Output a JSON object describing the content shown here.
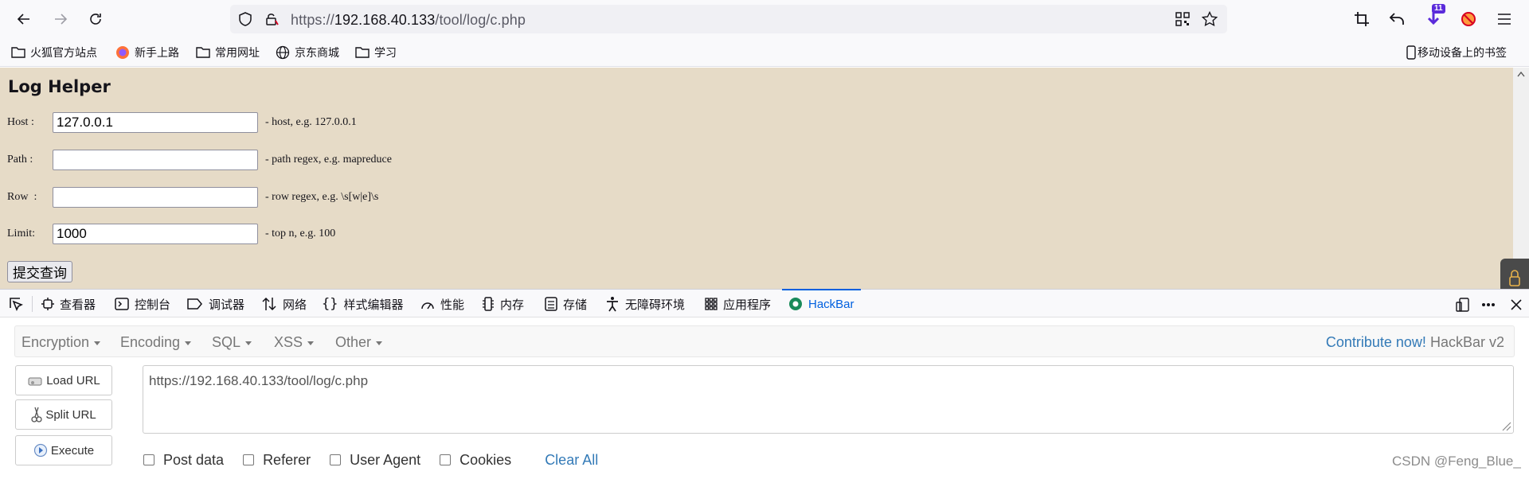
{
  "browser": {
    "url_prefix": "https://",
    "url_host": "192.168.40.133",
    "url_path": "/tool/log/c.php",
    "extension_badge": "11"
  },
  "bookmarks": [
    {
      "label": "火狐官方站点",
      "icon": "folder-icon"
    },
    {
      "label": "新手上路",
      "icon": "firefox-icon"
    },
    {
      "label": "常用网址",
      "icon": "folder-icon"
    },
    {
      "label": "京东商城",
      "icon": "globe-icon"
    },
    {
      "label": "学习",
      "icon": "folder-icon"
    }
  ],
  "mobile_bookmarks": "移动设备上的书签",
  "page": {
    "title": "Log Helper",
    "fields": [
      {
        "label": "Host :",
        "value": "127.0.0.1",
        "hint": "- host, e.g. 127.0.0.1"
      },
      {
        "label": "Path :",
        "value": "",
        "hint": "- path regex, e.g. mapreduce"
      },
      {
        "label": "Row  :",
        "value": "",
        "hint": "- row regex, e.g. \\s[w|e]\\s"
      },
      {
        "label": "Limit:",
        "value": "1000",
        "hint": "- top n, e.g. 100"
      }
    ],
    "submit": "提交查询"
  },
  "devtools": {
    "tabs": [
      {
        "label": "查看器",
        "icon": "inspector-icon"
      },
      {
        "label": "控制台",
        "icon": "console-icon"
      },
      {
        "label": "调试器",
        "icon": "debugger-icon"
      },
      {
        "label": "网络",
        "icon": "network-icon"
      },
      {
        "label": "样式编辑器",
        "icon": "style-editor-icon"
      },
      {
        "label": "性能",
        "icon": "performance-icon"
      },
      {
        "label": "内存",
        "icon": "memory-icon"
      },
      {
        "label": "存储",
        "icon": "storage-icon"
      },
      {
        "label": "无障碍环境",
        "icon": "accessibility-icon"
      },
      {
        "label": "应用程序",
        "icon": "application-icon"
      },
      {
        "label": "HackBar",
        "icon": "hackbar-icon",
        "active": true
      }
    ]
  },
  "hackbar": {
    "menu": [
      "Encryption",
      "Encoding",
      "SQL",
      "XSS",
      "Other"
    ],
    "contribute_link": "Contribute now!",
    "version": "HackBar v2",
    "buttons": [
      "Load URL",
      "Split URL",
      "Execute"
    ],
    "url_value": "https://192.168.40.133/tool/log/c.php",
    "checkboxes": [
      "Post data",
      "Referer",
      "User Agent",
      "Cookies"
    ],
    "clear_all": "Clear All"
  },
  "watermark": "CSDN @Feng_Blue_"
}
